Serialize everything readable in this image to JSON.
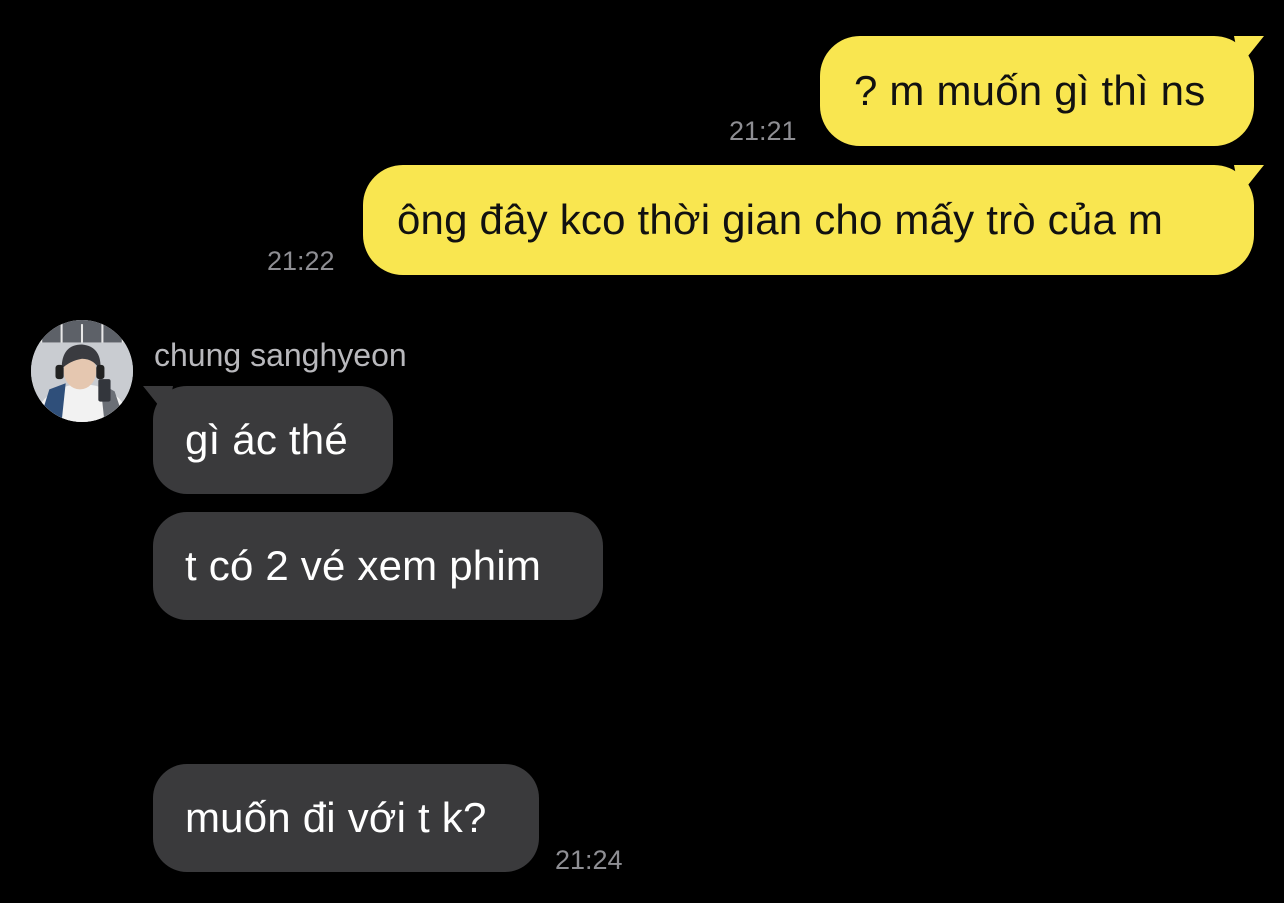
{
  "messages": [
    {
      "direction": "outgoing",
      "text": "? m muốn gì thì ns",
      "time": "21:21"
    },
    {
      "direction": "outgoing",
      "text": "ông đây kco thời gian cho mấy trò của m",
      "time": "21:22"
    },
    {
      "direction": "incoming",
      "text": "gì ác thé"
    },
    {
      "direction": "incoming",
      "text": "t có 2 vé xem phim"
    },
    {
      "direction": "incoming",
      "text": "muốn đi với t k?",
      "time": "21:24"
    }
  ],
  "contact": {
    "name": "chung sanghyeon",
    "avatar_icon": "profile-photo"
  },
  "colors": {
    "background": "#000000",
    "outgoing_bubble": "#f9e650",
    "incoming_bubble": "#3a3a3c",
    "timestamp": "#8e8e93",
    "sender_name": "#b8b8bc"
  }
}
